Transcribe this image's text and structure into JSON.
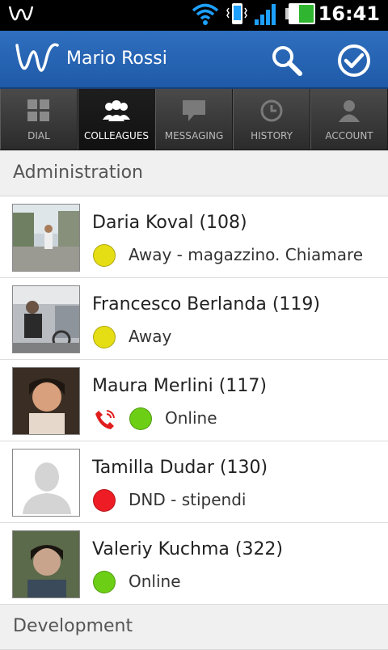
{
  "statusbar": {
    "time": "16:41"
  },
  "appbar": {
    "user_name": "Mario Rossi"
  },
  "tabs": [
    {
      "label": "DIAL",
      "icon": "grid-icon",
      "active": false
    },
    {
      "label": "COLLEAGUES",
      "icon": "people-icon",
      "active": true
    },
    {
      "label": "MESSAGING",
      "icon": "chat-icon",
      "active": false
    },
    {
      "label": "HISTORY",
      "icon": "clock-icon",
      "active": false
    },
    {
      "label": "ACCOUNT",
      "icon": "person-icon",
      "active": false
    }
  ],
  "sections": {
    "administration": "Administration",
    "development": "Development"
  },
  "contacts": [
    {
      "name": "Daria Koval (108)",
      "status": "Away - magazzino. Chiamare",
      "status_color": "#e6de14",
      "in_call": false
    },
    {
      "name": "Francesco Berlanda (119)",
      "status": "Away",
      "status_color": "#e6de14",
      "in_call": false
    },
    {
      "name": "Maura Merlini (117)",
      "status": "Online",
      "status_color": "#6ccf16",
      "in_call": true
    },
    {
      "name": "Tamilla Dudar (130)",
      "status": "DND - stipendi",
      "status_color": "#ee1c24",
      "in_call": false
    },
    {
      "name": "Valeriy Kuchma (322)",
      "status": "Online",
      "status_color": "#6ccf16",
      "in_call": false
    }
  ]
}
